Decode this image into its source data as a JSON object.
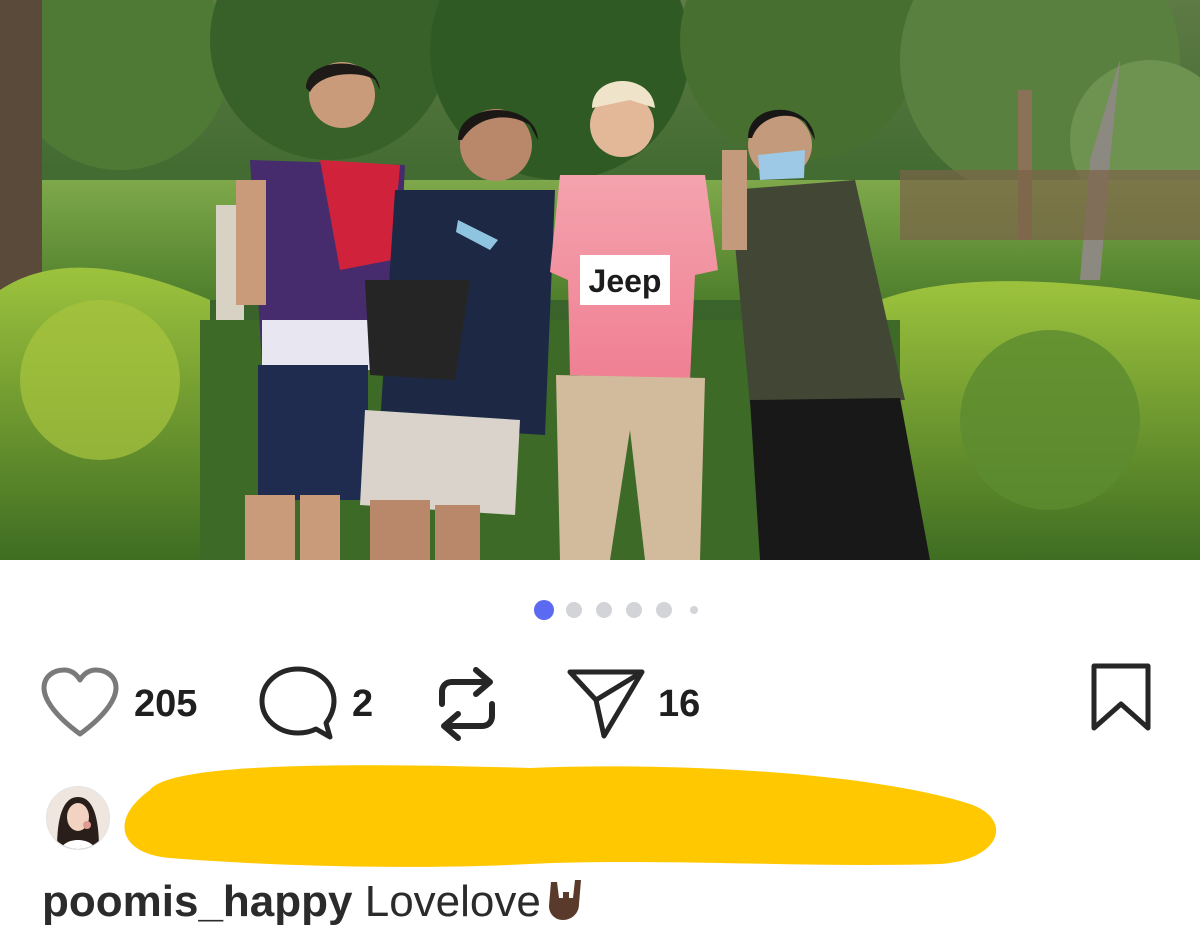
{
  "post": {
    "image_alt": "Four men posing outdoors in front of green bushes and trees",
    "carousel": {
      "total": 6,
      "active_index": 0
    }
  },
  "actions": {
    "likes": "205",
    "comments": "2",
    "shares": "16"
  },
  "icons": [
    "heart-icon",
    "comment-icon",
    "repost-icon",
    "send-icon",
    "bookmark-icon"
  ],
  "caption": {
    "username": "poomis_happy",
    "text": "Lovelove",
    "emoji": "sign-of-the-horns-emoji"
  },
  "colors": {
    "carousel_active": "#5b6af0",
    "carousel_inactive": "#d3d4d7",
    "redaction": "#ffc800"
  }
}
